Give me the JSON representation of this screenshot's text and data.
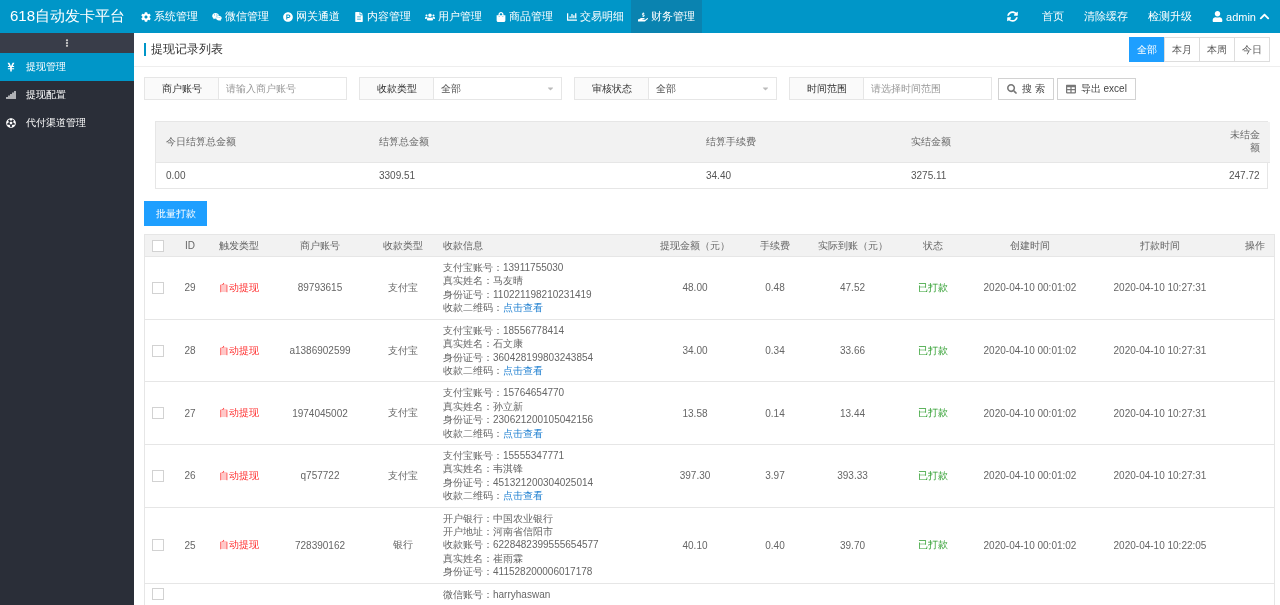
{
  "brand": "618自动发卡平台",
  "nav": [
    {
      "label": "系统管理",
      "selected": false
    },
    {
      "label": "微信管理",
      "selected": false
    },
    {
      "label": "网关通道",
      "selected": false
    },
    {
      "label": "内容管理",
      "selected": false
    },
    {
      "label": "用户管理",
      "selected": false
    },
    {
      "label": "商品管理",
      "selected": false
    },
    {
      "label": "交易明细",
      "selected": false
    },
    {
      "label": "财务管理",
      "selected": true
    }
  ],
  "top_links": [
    "首页",
    "清除缓存",
    "检测升级"
  ],
  "user": "admin",
  "sidebar": [
    {
      "label": "提现管理",
      "selected": true
    },
    {
      "label": "提现配置",
      "selected": false
    },
    {
      "label": "代付渠道管理",
      "selected": false
    }
  ],
  "page_title": "提现记录列表",
  "range_tabs": [
    {
      "label": "全部",
      "selected": true
    },
    {
      "label": "本月",
      "selected": false
    },
    {
      "label": "本周",
      "selected": false
    },
    {
      "label": "今日",
      "selected": false
    }
  ],
  "filters": [
    {
      "kind": "input",
      "label": "商户账号",
      "placeholder": "请输入商户账号"
    },
    {
      "kind": "select",
      "label": "收款类型",
      "value": "全部"
    },
    {
      "kind": "select",
      "label": "审核状态",
      "value": "全部"
    },
    {
      "kind": "input",
      "label": "时间范围",
      "placeholder": "请选择时间范围"
    }
  ],
  "search_button": "搜 索",
  "export_button": "导出 excel",
  "summary": [
    {
      "label": "今日结算总金额",
      "value": "0.00"
    },
    {
      "label": "结算总金额",
      "value": "3309.51"
    },
    {
      "label": "结算手续费",
      "value": "34.40"
    },
    {
      "label": "实结金额",
      "value": "3275.11"
    },
    {
      "label": "未结金额",
      "value": "247.72"
    }
  ],
  "batch_button": "批量打款",
  "table": {
    "header_checked": false,
    "columns": [
      "ID",
      "触发类型",
      "商户账号",
      "收款类型",
      "收款信息",
      "提现金额（元）",
      "手续费",
      "实际到账（元）",
      "状态",
      "创建时间",
      "打款时间",
      "操作"
    ],
    "rows": [
      {
        "checked": false,
        "id": "29",
        "trigger": "自动提现",
        "account": "89793615",
        "pay_type": "支付宝",
        "info": [
          {
            "kind": "text",
            "text": "支付宝账号：13911755030"
          },
          {
            "kind": "text",
            "text": "真实姓名：马友晴"
          },
          {
            "kind": "text",
            "text": "身份证号：110221198210231419"
          },
          {
            "kind": "link",
            "text": "收款二维码：",
            "link": "点击查看"
          }
        ],
        "amount": "48.00",
        "fee": "0.48",
        "net": "47.52",
        "status": "已打款",
        "created": "2020-04-10 00:01:02",
        "paid": "2020-04-10 10:27:31"
      },
      {
        "checked": false,
        "id": "28",
        "trigger": "自动提现",
        "account": "a1386902599",
        "pay_type": "支付宝",
        "info": [
          {
            "kind": "text",
            "text": "支付宝账号：18556778414"
          },
          {
            "kind": "text",
            "text": "真实姓名：石文康"
          },
          {
            "kind": "text",
            "text": "身份证号：360428199803243854"
          },
          {
            "kind": "link",
            "text": "收款二维码：",
            "link": "点击查看"
          }
        ],
        "amount": "34.00",
        "fee": "0.34",
        "net": "33.66",
        "status": "已打款",
        "created": "2020-04-10 00:01:02",
        "paid": "2020-04-10 10:27:31"
      },
      {
        "checked": false,
        "id": "27",
        "trigger": "自动提现",
        "account": "1974045002",
        "pay_type": "支付宝",
        "info": [
          {
            "kind": "text",
            "text": "支付宝账号：15764654770"
          },
          {
            "kind": "text",
            "text": "真实姓名：孙立新"
          },
          {
            "kind": "text",
            "text": "身份证号：230621200105042156"
          },
          {
            "kind": "link",
            "text": "收款二维码：",
            "link": "点击查看"
          }
        ],
        "amount": "13.58",
        "fee": "0.14",
        "net": "13.44",
        "status": "已打款",
        "created": "2020-04-10 00:01:02",
        "paid": "2020-04-10 10:27:31"
      },
      {
        "checked": false,
        "id": "26",
        "trigger": "自动提现",
        "account": "q757722",
        "pay_type": "支付宝",
        "info": [
          {
            "kind": "text",
            "text": "支付宝账号：15555347771"
          },
          {
            "kind": "text",
            "text": "真实姓名：韦淇锋"
          },
          {
            "kind": "text",
            "text": "身份证号：451321200304025014"
          },
          {
            "kind": "link",
            "text": "收款二维码：",
            "link": "点击查看"
          }
        ],
        "amount": "397.30",
        "fee": "3.97",
        "net": "393.33",
        "status": "已打款",
        "created": "2020-04-10 00:01:02",
        "paid": "2020-04-10 10:27:31"
      },
      {
        "checked": false,
        "id": "25",
        "trigger": "自动提现",
        "account": "728390162",
        "pay_type": "银行",
        "info": [
          {
            "kind": "text",
            "text": "开户银行：中国农业银行"
          },
          {
            "kind": "text",
            "text": "开户地址：河南省信阳市"
          },
          {
            "kind": "text",
            "text": "收款账号：6228482399555654577"
          },
          {
            "kind": "text",
            "text": "真实姓名：崔雨霖"
          },
          {
            "kind": "text",
            "text": "身份证号：411528200006017178"
          }
        ],
        "amount": "40.10",
        "fee": "0.40",
        "net": "39.70",
        "status": "已打款",
        "created": "2020-04-10 00:01:02",
        "paid": "2020-04-10 10:22:05"
      },
      {
        "checked": false,
        "id": "",
        "trigger": "",
        "account": "",
        "pay_type": "",
        "info": [
          {
            "kind": "text",
            "text": "微信账号：harryhaswan"
          }
        ],
        "amount": "",
        "fee": "",
        "net": "",
        "status": "",
        "created": "",
        "paid": ""
      }
    ]
  }
}
